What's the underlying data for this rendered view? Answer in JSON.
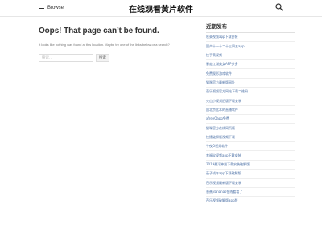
{
  "header": {
    "menu_label": "Browse",
    "site_title": "在线观看黄片软件"
  },
  "main": {
    "title": "Oops! That page can’t be found.",
    "description": "It looks like nothing was found at this location. Maybe try one of the links below or a search?",
    "search_placeholder": "搜索…",
    "search_button": "搜索"
  },
  "sidebar": {
    "title": "近期发布",
    "posts": [
      "秋葵视频app下载安装",
      "国产十一十二十三四五app",
      "快手黄视频",
      "暴走江湖美女APP多多",
      "免费观影游戏软件",
      "猫咪官方最新版网址",
      "芭乐视频官方网站下载二维码",
      "火山小视频旧版下载安装",
      "国北京比本的直播软件",
      "xfreeQapp免费",
      "猫咪官方在线网页版",
      "快播破解版视频下载",
      "午夜D视频软件",
      "幸福宝视频app下载安装",
      "2019最污神器下载安装破解版",
      "茄子成年app下载破解版",
      "芭乐视频最新版下载安装",
      "香蕉Bananas在线看看了",
      "芭乐视频破解版app版"
    ]
  }
}
